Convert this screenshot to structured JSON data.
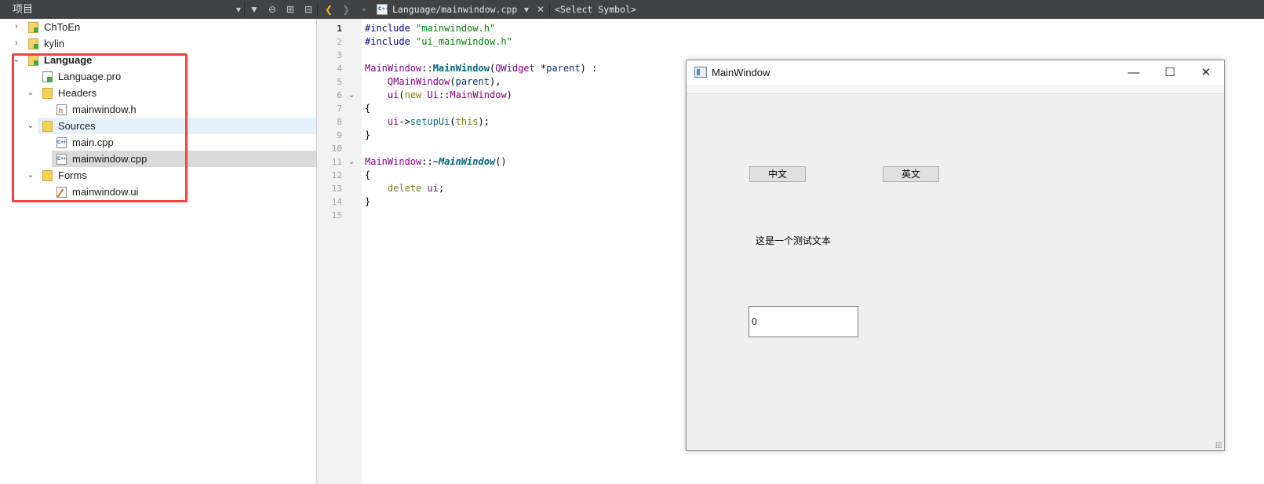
{
  "toolbar": {
    "panel_title": "项目",
    "file_path": "Language/mainwindow.cpp",
    "symbol_selector": "<Select Symbol>"
  },
  "tree": [
    {
      "label": "ChToEn",
      "expanded": false,
      "icon": "project-icon"
    },
    {
      "label": "kylin",
      "expanded": false,
      "icon": "project-icon"
    },
    {
      "label": "Language",
      "expanded": true,
      "icon": "project-icon"
    },
    {
      "label": "Language.pro",
      "icon": "pro-file-icon"
    },
    {
      "label": "Headers",
      "expanded": true,
      "icon": "headers-folder-icon"
    },
    {
      "label": "mainwindow.h",
      "icon": "header-file-icon"
    },
    {
      "label": "Sources",
      "expanded": true,
      "icon": "sources-folder-icon"
    },
    {
      "label": "main.cpp",
      "icon": "cpp-file-icon"
    },
    {
      "label": "mainwindow.cpp",
      "icon": "cpp-file-icon",
      "selected": true
    },
    {
      "label": "Forms",
      "expanded": true,
      "icon": "forms-folder-icon"
    },
    {
      "label": "mainwindow.ui",
      "icon": "ui-file-icon"
    }
  ],
  "editor": {
    "line_numbers": [
      "1",
      "2",
      "3",
      "4",
      "5",
      "6",
      "7",
      "8",
      "9",
      "10",
      "11",
      "12",
      "13",
      "14",
      "15"
    ],
    "code_lines": [
      [
        [
          "#include ",
          "prep"
        ],
        [
          "\"mainwindow.h\"",
          "str"
        ]
      ],
      [
        [
          "#include ",
          "prep"
        ],
        [
          "\"ui_mainwindow.h\"",
          "str"
        ]
      ],
      [],
      [
        [
          "MainWindow",
          "type"
        ],
        [
          "::",
          "punc"
        ],
        [
          "MainWindow",
          "fn"
        ],
        [
          "(",
          "punc"
        ],
        [
          "QWidget",
          "type"
        ],
        [
          " *",
          "punc"
        ],
        [
          "parent",
          "var"
        ],
        [
          ") :",
          "punc"
        ]
      ],
      [
        [
          "    ",
          "punc"
        ],
        [
          "QMainWindow",
          "type"
        ],
        [
          "(",
          "punc"
        ],
        [
          "parent",
          "var"
        ],
        [
          "),",
          "punc"
        ]
      ],
      [
        [
          "    ",
          "punc"
        ],
        [
          "ui",
          "type"
        ],
        [
          "(",
          "punc"
        ],
        [
          "new",
          "kw"
        ],
        [
          " ",
          "punc"
        ],
        [
          "Ui",
          "type"
        ],
        [
          "::",
          "punc"
        ],
        [
          "MainWindow",
          "type"
        ],
        [
          ")",
          "punc"
        ]
      ],
      [
        [
          "{",
          "punc"
        ]
      ],
      [
        [
          "    ",
          "punc"
        ],
        [
          "ui",
          "type"
        ],
        [
          "->",
          "punc"
        ],
        [
          "setupUi",
          "call"
        ],
        [
          "(",
          "punc"
        ],
        [
          "this",
          "kw"
        ],
        [
          ");",
          "punc"
        ]
      ],
      [
        [
          "}",
          "punc"
        ]
      ],
      [],
      [
        [
          "MainWindow",
          "type"
        ],
        [
          "::~",
          "punc"
        ],
        [
          "MainWindow",
          "fni"
        ],
        [
          "()",
          "punc"
        ]
      ],
      [
        [
          "{",
          "punc"
        ]
      ],
      [
        [
          "    ",
          "punc"
        ],
        [
          "delete",
          "kw"
        ],
        [
          " ",
          "punc"
        ],
        [
          "ui",
          "type"
        ],
        [
          ";",
          "punc"
        ]
      ],
      [
        [
          "}",
          "punc"
        ]
      ],
      []
    ]
  },
  "mainwindow": {
    "title": "MainWindow",
    "minimize": "—",
    "maximize": "☐",
    "close": "✕",
    "btn_chinese": "中文",
    "btn_english": "英文",
    "label_text": "这是一个测试文本",
    "input_value": "0"
  }
}
